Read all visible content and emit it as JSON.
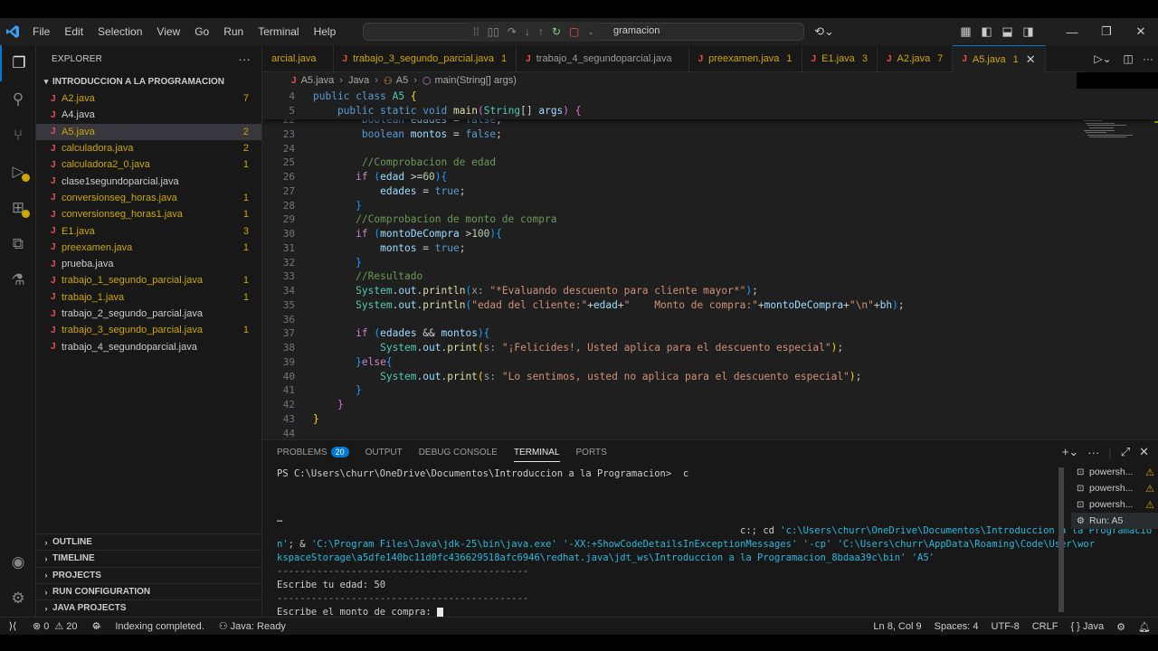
{
  "menu": [
    "File",
    "Edit",
    "Selection",
    "View",
    "Go",
    "Run",
    "Terminal",
    "Help"
  ],
  "command_center": {
    "text": "gramacion"
  },
  "explorer": {
    "title": "EXPLORER",
    "folder": "INTRODUCCION A LA PROGRAMACION",
    "files": [
      {
        "name": "A2.java",
        "count": "7",
        "state": "warn"
      },
      {
        "name": "A4.java",
        "count": "",
        "state": "plain"
      },
      {
        "name": "A5.java",
        "count": "2",
        "state": "warn-sel"
      },
      {
        "name": "calculadora.java",
        "count": "2",
        "state": "warn"
      },
      {
        "name": "calculadora2_0.java",
        "count": "1",
        "state": "warn"
      },
      {
        "name": "clase1segundoparcial.java",
        "count": "",
        "state": "plain"
      },
      {
        "name": "conversionseg_horas.java",
        "count": "1",
        "state": "warn"
      },
      {
        "name": "conversionseg_horas1.java",
        "count": "1",
        "state": "warn"
      },
      {
        "name": "E1.java",
        "count": "3",
        "state": "warn"
      },
      {
        "name": "preexamen.java",
        "count": "1",
        "state": "warn"
      },
      {
        "name": "prueba.java",
        "count": "",
        "state": "plain"
      },
      {
        "name": "trabajo_1_segundo_parcial.java",
        "count": "1",
        "state": "warn"
      },
      {
        "name": "trabajo_1.java",
        "count": "1",
        "state": "warn"
      },
      {
        "name": "trabajo_2_segundo_parcial.java",
        "count": "",
        "state": "plain"
      },
      {
        "name": "trabajo_3_segundo_parcial.java",
        "count": "1",
        "state": "warn"
      },
      {
        "name": "trabajo_4_segundoparcial.java",
        "count": "",
        "state": "plain"
      }
    ],
    "sections": [
      "OUTLINE",
      "TIMELINE",
      "PROJECTS",
      "RUN CONFIGURATION",
      "JAVA PROJECTS"
    ]
  },
  "tabs": [
    {
      "name": "arcial.java",
      "count": "",
      "state": "warn"
    },
    {
      "name": "trabajo_3_segundo_parcial.java",
      "count": "1",
      "state": "warn"
    },
    {
      "name": "trabajo_4_segundoparcial.java",
      "count": "",
      "state": "plain"
    },
    {
      "name": "preexamen.java",
      "count": "1",
      "state": "warn"
    },
    {
      "name": "E1.java",
      "count": "3",
      "state": "warn"
    },
    {
      "name": "A2.java",
      "count": "7",
      "state": "warn"
    },
    {
      "name": "A5.java",
      "count": "1",
      "state": "active"
    }
  ],
  "breadcrumb": [
    "A5.java",
    "Java",
    "A5",
    "main(String[] args)"
  ],
  "editor": {
    "sticky": [
      {
        "n": "4",
        "html": "<span class='kw'>public</span> <span class='kw'>class</span> <span class='ty'>A5</span> <span class='br1'>{</span>"
      },
      {
        "n": "5",
        "html": "    <span class='kw'>public</span> <span class='kw'>static</span> <span class='kw'>void</span> <span class='fn'>main</span><span class='br2'>(</span><span class='ty'>String</span>[] <span class='var'>args</span><span class='br2'>)</span> <span class='br2'>{</span>"
      }
    ],
    "lines": [
      {
        "n": "22",
        "html": "        <span class='kw'>boolean</span> <span class='var'>edades</span> = <span class='kw'>false</span>;"
      },
      {
        "n": "23",
        "html": "        <span class='kw'>boolean</span> <span class='var'>montos</span> = <span class='kw'>false</span>;"
      },
      {
        "n": "24",
        "html": ""
      },
      {
        "n": "25",
        "html": "        <span class='cmt'>//Comprobacion de edad</span>"
      },
      {
        "n": "26",
        "html": "       <span class='ctl'>if</span> <span class='br3'>(</span><span class='var'>edad</span> &gt;=<span class='num'>60</span><span class='br3'>){</span>"
      },
      {
        "n": "27",
        "html": "           <span class='var'>edades</span> = <span class='kw'>true</span>;"
      },
      {
        "n": "28",
        "html": "       <span class='br3'>}</span>"
      },
      {
        "n": "29",
        "html": "       <span class='cmt'>//Comprobacion de monto de compra</span>"
      },
      {
        "n": "30",
        "html": "       <span class='ctl'>if</span> <span class='br3'>(</span><span class='var'>montoDeCompra</span> &gt;<span class='num'>100</span><span class='br3'>){</span>"
      },
      {
        "n": "31",
        "html": "           <span class='var'>montos</span> = <span class='kw'>true</span>;"
      },
      {
        "n": "32",
        "html": "       <span class='br3'>}</span>"
      },
      {
        "n": "33",
        "html": "       <span class='cmt'>//Resultado</span>"
      },
      {
        "n": "34",
        "html": "       <span class='ty'>System</span>.<span class='var'>out</span>.<span class='fn'>println</span><span class='br3'>(</span><span class='hint'>x: </span><span class='str'>\"*Evaluando descuento para cliente mayor*\"</span><span class='br3'>)</span>;"
      },
      {
        "n": "35",
        "html": "       <span class='ty'>System</span>.<span class='var'>out</span>.<span class='fn'>println</span><span class='br3'>(</span><span class='str'>\"edad del cliente:\"</span>+<span class='var'>edad</span>+<span class='str'>\"    Monto de compra:\"</span>+<span class='var'>montoDeCompra</span>+<span class='str'>\"\\n\"</span>+<span class='var'>bh</span><span class='br3'>)</span>;"
      },
      {
        "n": "36",
        "html": ""
      },
      {
        "n": "37",
        "html": "       <span class='ctl'>if</span> <span class='br3'>(</span><span class='var'>edades</span> &amp;&amp; <span class='var'>montos</span><span class='br3'>){</span>"
      },
      {
        "n": "38",
        "html": "           <span class='ty'>System</span>.<span class='var'>out</span>.<span class='fn'>print</span><span class='br1'>(</span><span class='hint'>s: </span><span class='str'>\"¡Felicides!, Usted aplica para el descuento especial\"</span><span class='br1'>)</span>;"
      },
      {
        "n": "39",
        "html": "       <span class='br3'>}</span><span class='ctl'>else</span><span class='br3'>{</span>"
      },
      {
        "n": "40",
        "html": "           <span class='ty'>System</span>.<span class='var'>out</span>.<span class='fn'>print</span><span class='br1'>(</span><span class='hint'>s: </span><span class='str'>\"Lo sentimos, usted no aplica para el descuento especial\"</span><span class='br1'>)</span>;"
      },
      {
        "n": "41",
        "html": "       <span class='br3'>}</span>"
      },
      {
        "n": "42",
        "html": "    <span class='br2'>}</span>"
      },
      {
        "n": "43",
        "html": "<span class='br1'>}</span>"
      },
      {
        "n": "44",
        "html": ""
      }
    ]
  },
  "panel": {
    "tabs": [
      "PROBLEMS",
      "OUTPUT",
      "DEBUG CONSOLE",
      "TERMINAL",
      "PORTS"
    ],
    "problems_count": "20",
    "terminal_lines": [
      {
        "html": "PS C:\\Users\\churr\\OneDrive\\Documentos\\Introduccion a la Programacion&gt;  c"
      },
      {
        "html": ""
      },
      {
        "html": ""
      },
      {
        "html": "…"
      },
      {
        "html": "                                                                                 c:; cd <span class='tcyan'>'c:\\Users\\churr\\OneDrive\\Documentos\\Introduccion a la Programacio</span>"
      },
      {
        "html": "<span class='tcyan'>n'</span>; &amp; <span class='tcyan'>'C:\\Program Files\\Java\\jdk-25\\bin\\java.exe'</span> <span class='tcyan'>'-XX:+ShowCodeDetailsInExceptionMessages'</span> <span class='tcyan'>'-cp'</span> <span class='tcyan'>'C:\\Users\\churr\\AppData\\Roaming\\Code\\User\\wor</span>"
      },
      {
        "html": "<span class='tcyan'>kspaceStorage\\a5dfe140bc11d0fc436629518afc6946\\redhat.java\\jdt_ws\\Introduccion a la Programacion_8bdaa39c\\bin'</span> <span class='tcyan'>'A5'</span>"
      },
      {
        "html": "<span class='tdim'>--------------------------------------------</span>"
      },
      {
        "html": "Escribe tu edad: 50"
      },
      {
        "html": "<span class='tdim'>--------------------------------------------</span>"
      },
      {
        "html": "Escribe el monto de compra: <span class='cursor'></span>"
      }
    ],
    "terminals": [
      {
        "name": "powersh...",
        "warn": true
      },
      {
        "name": "powersh...",
        "warn": true
      },
      {
        "name": "powersh...",
        "warn": true
      },
      {
        "name": "Run: A5",
        "warn": false
      }
    ]
  },
  "status": {
    "errors": "0",
    "warnings": "20",
    "indexing": "Indexing completed.",
    "java_status": "Java: Ready",
    "position": "Ln 8, Col 9",
    "spaces": "Spaces: 4",
    "encoding": "UTF-8",
    "eol": "CRLF",
    "language": "Java"
  },
  "colors": {
    "accent": "#0078d4",
    "warning": "#cca700",
    "java_icon": "#f14c4c"
  }
}
